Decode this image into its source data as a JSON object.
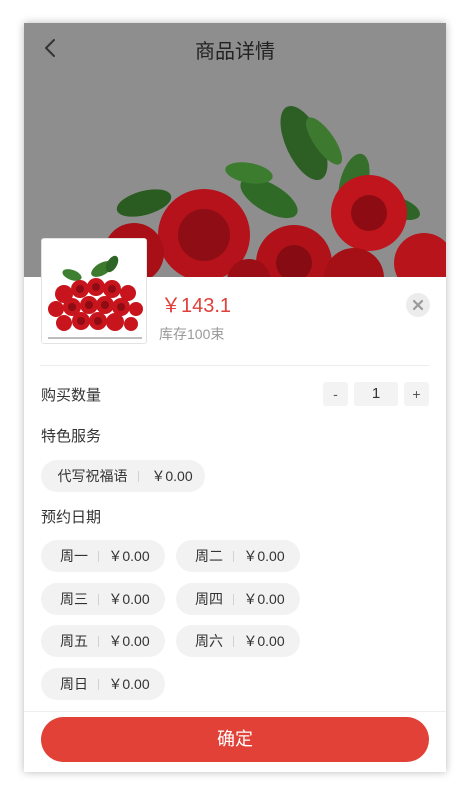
{
  "header": {
    "title": "商品详情",
    "back_icon": "chevron-left-icon"
  },
  "product": {
    "price": "￥143.1",
    "stock": "库存100束"
  },
  "quantity": {
    "label": "购买数量",
    "minus": "-",
    "value": "1",
    "plus": "+"
  },
  "services": {
    "label": "特色服务",
    "items": [
      {
        "name": "代写祝福语",
        "price": "￥0.00"
      }
    ]
  },
  "booking": {
    "label": "预约日期",
    "days": [
      {
        "name": "周一",
        "price": "￥0.00"
      },
      {
        "name": "周二",
        "price": "￥0.00"
      },
      {
        "name": "周三",
        "price": "￥0.00"
      },
      {
        "name": "周四",
        "price": "￥0.00"
      },
      {
        "name": "周五",
        "price": "￥0.00"
      },
      {
        "name": "周六",
        "price": "￥0.00"
      },
      {
        "name": "周日",
        "price": "￥0.00"
      }
    ]
  },
  "footer": {
    "confirm_label": "确定"
  },
  "colors": {
    "accent": "#e14136",
    "price": "#e0403a",
    "overlay": "#8e8e8e",
    "chip_bg": "#f2f2f2"
  }
}
